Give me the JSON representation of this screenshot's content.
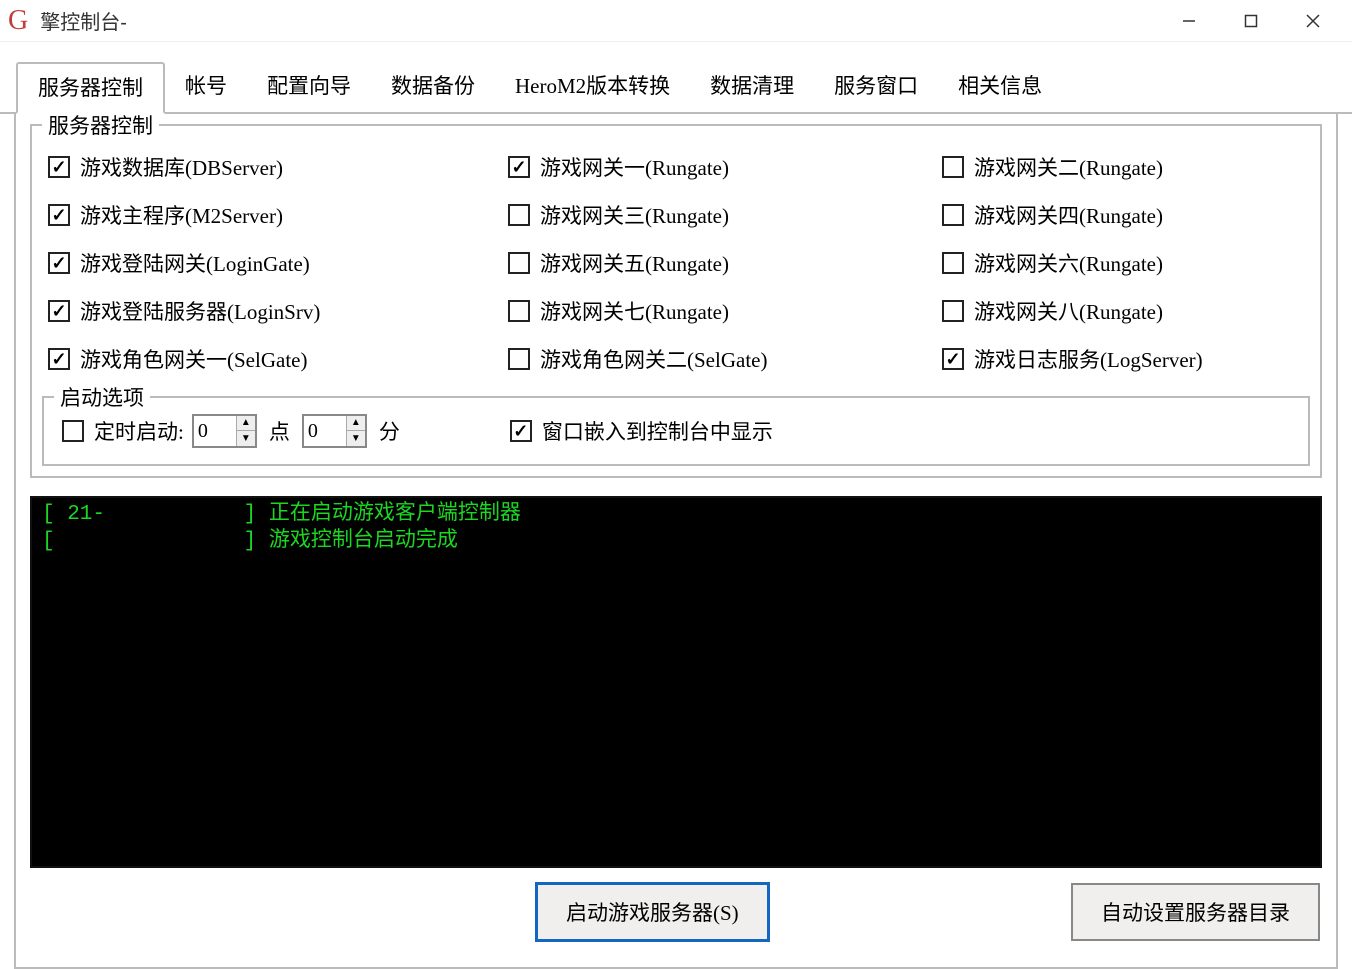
{
  "titlebar": {
    "icon_text": "G",
    "title": "擎控制台-"
  },
  "tabs": [
    {
      "label": "服务器控制",
      "active": true
    },
    {
      "label": "帐号",
      "active": false
    },
    {
      "label": "配置向导",
      "active": false
    },
    {
      "label": "数据备份",
      "active": false
    },
    {
      "label": "HeroM2版本转换",
      "active": false
    },
    {
      "label": "数据清理",
      "active": false
    },
    {
      "label": "服务窗口",
      "active": false
    },
    {
      "label": "相关信息",
      "active": false
    }
  ],
  "server_control": {
    "legend": "服务器控制",
    "rows": [
      [
        {
          "label": "游戏数据库(DBServer)",
          "checked": true
        },
        {
          "label": "游戏网关一(Rungate)",
          "checked": true
        },
        {
          "label": "游戏网关二(Rungate)",
          "checked": false
        }
      ],
      [
        {
          "label": "游戏主程序(M2Server)",
          "checked": true
        },
        {
          "label": "游戏网关三(Rungate)",
          "checked": false
        },
        {
          "label": "游戏网关四(Rungate)",
          "checked": false
        }
      ],
      [
        {
          "label": "游戏登陆网关(LoginGate)",
          "checked": true
        },
        {
          "label": "游戏网关五(Rungate)",
          "checked": false
        },
        {
          "label": "游戏网关六(Rungate)",
          "checked": false
        }
      ],
      [
        {
          "label": "游戏登陆服务器(LoginSrv)",
          "checked": true
        },
        {
          "label": "游戏网关七(Rungate)",
          "checked": false
        },
        {
          "label": "游戏网关八(Rungate)",
          "checked": false
        }
      ],
      [
        {
          "label": "游戏角色网关一(SelGate)",
          "checked": true
        },
        {
          "label": "游戏角色网关二(SelGate)",
          "checked": false
        },
        {
          "label": "游戏日志服务(LogServer)",
          "checked": true
        }
      ]
    ]
  },
  "start_options": {
    "legend": "启动选项",
    "timed_start_label": "定时启动:",
    "timed_start_checked": false,
    "hour_value": "0",
    "hour_suffix": "点",
    "minute_value": "0",
    "minute_suffix": "分",
    "embed_window_label": "窗口嵌入到控制台中显示",
    "embed_window_checked": true
  },
  "console": {
    "lines": [
      "[ 21-           ] 正在启动游戏客户端控制器",
      "[               ] 游戏控制台启动完成"
    ]
  },
  "buttons": {
    "start_server": "启动游戏服务器(S)",
    "auto_set_dir": "自动设置服务器目录"
  }
}
